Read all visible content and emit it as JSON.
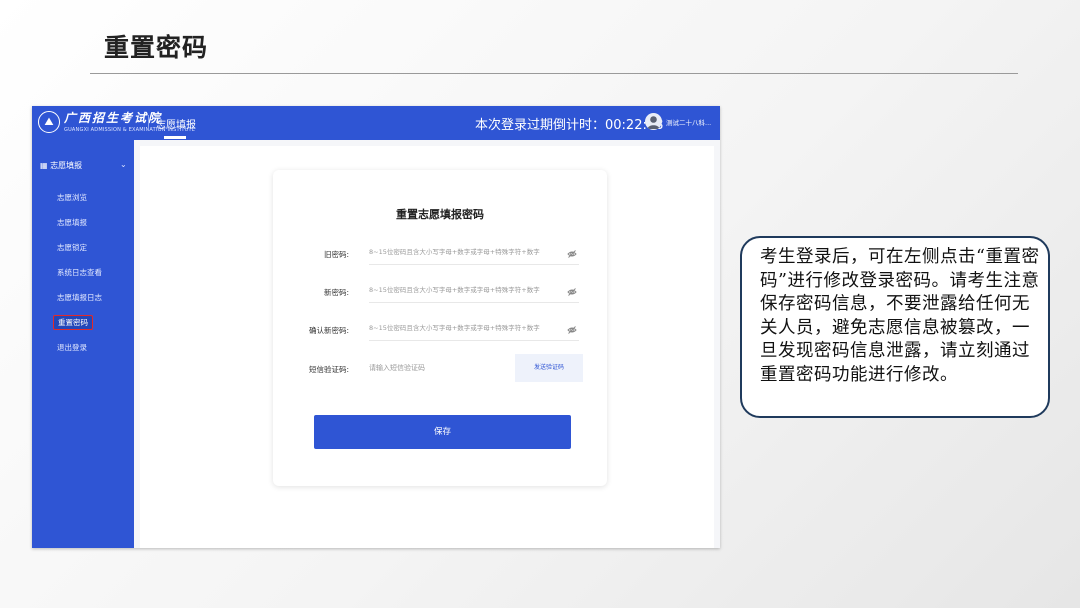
{
  "slide": {
    "title": "重置密码",
    "callout": "考生登录后，可在左侧点击“重置密码”进行修改登录密码。请考生注意保存密码信息，不要泄露给任何无关人员，避免志愿信息被篡改，一旦发现密码信息泄露，请立刻通过重置密码功能进行修改。"
  },
  "app": {
    "logo_title": "广西招生考试院",
    "logo_sub": "GUANGXI ADMISSION & EXAMINATION INSTITUTE",
    "top_nav_tab": "志愿填报",
    "countdown": "本次登录过期倒计时：00:22:48",
    "user_name": "测试二十八科...",
    "accent_color": "#2f55d4",
    "sidebar": {
      "group_label": "志愿填报",
      "group_icon": "grid-icon",
      "items": [
        {
          "label": "志愿浏览"
        },
        {
          "label": "志愿填报"
        },
        {
          "label": "志愿锁定"
        },
        {
          "label": "系统日志查看"
        },
        {
          "label": "志愿填报日志"
        },
        {
          "label": "重置密码",
          "active": true
        },
        {
          "label": "退出登录"
        }
      ]
    },
    "form": {
      "title": "重置志愿填报密码",
      "old_password_label": "旧密码:",
      "old_password_placeholder": "8~15位密码且含大小写字母+数字或字母+特殊字符+数字",
      "new_password_label": "新密码:",
      "new_password_placeholder": "8~15位密码且含大小写字母+数字或字母+特殊字符+数字",
      "confirm_password_label": "确认新密码:",
      "confirm_password_placeholder": "8~15位密码且含大小写字母+数字或字母+特殊字符+数字",
      "sms_label": "短信验证码:",
      "sms_placeholder": "请输入短信验证码",
      "send_code_label": "发送验证码",
      "save_label": "保存"
    }
  }
}
